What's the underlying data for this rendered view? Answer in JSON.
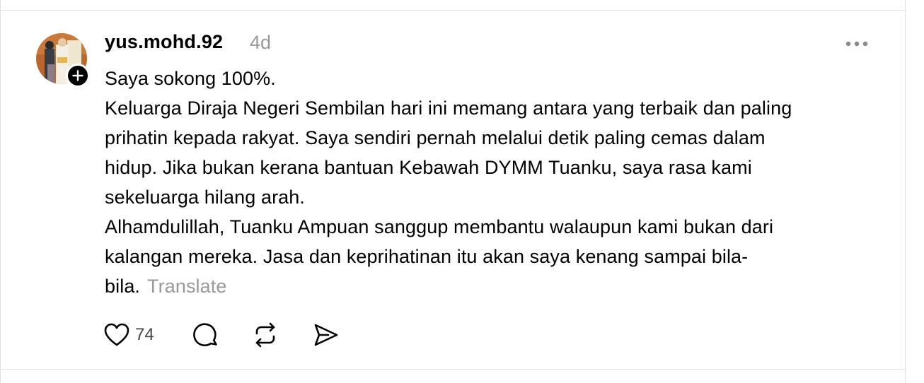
{
  "post": {
    "username": "yus.mohd.92",
    "time": "4d",
    "lines": [
      "Saya sokong 100%.",
      "Keluarga Diraja Negeri Sembilan hari ini memang antara yang terbaik dan paling",
      "prihatin kepada rakyat. Saya sendiri pernah melalui detik paling cemas dalam",
      "hidup. Jika bukan kerana bantuan Kebawah DYMM Tuanku, saya rasa kami",
      "sekeluarga hilang arah.",
      "Alhamdulillah, Tuanku Ampuan sanggup membantu walaupun kami bukan dari",
      "kalangan mereka. Jasa dan keprihatinan itu akan saya kenang sampai bila-",
      "bila."
    ],
    "translate_label": "Translate",
    "likes": "74"
  },
  "icons": {
    "more": "more-dots-icon",
    "follow": "plus-icon",
    "like": "heart-icon",
    "reply": "comment-icon",
    "repost": "repost-icon",
    "share": "send-icon"
  },
  "colors": {
    "text": "#000000",
    "muted": "#999999",
    "divider": "#e1e1e1"
  }
}
